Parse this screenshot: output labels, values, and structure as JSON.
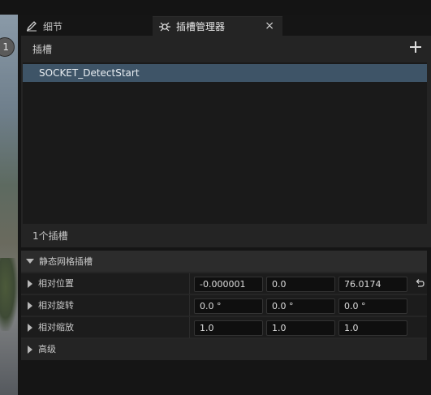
{
  "tabs": [
    {
      "label": "细节",
      "icon": "pencil-icon"
    },
    {
      "label": "插槽管理器",
      "icon": "socket-manager-icon",
      "close": "×"
    }
  ],
  "viewport": {
    "badge": "1"
  },
  "socket_panel": {
    "title": "插槽",
    "add_icon": "plus-icon",
    "sockets": [
      "SOCKET_DetectStart"
    ],
    "footer": "1个插槽"
  },
  "details": {
    "section_title": "静态网格插槽",
    "rows": [
      {
        "label": "相对位置",
        "values": [
          "-0.000001",
          "0.0",
          "76.0174"
        ]
      },
      {
        "label": "相对旋转",
        "values": [
          "0.0 °",
          "0.0 °",
          "0.0 °"
        ]
      },
      {
        "label": "相对缩放",
        "values": [
          "1.0",
          "1.0",
          "1.0"
        ]
      }
    ],
    "advanced_label": "高级"
  },
  "colors": {
    "selection": "#3e5467",
    "panel": "#242424",
    "background": "#151515"
  }
}
